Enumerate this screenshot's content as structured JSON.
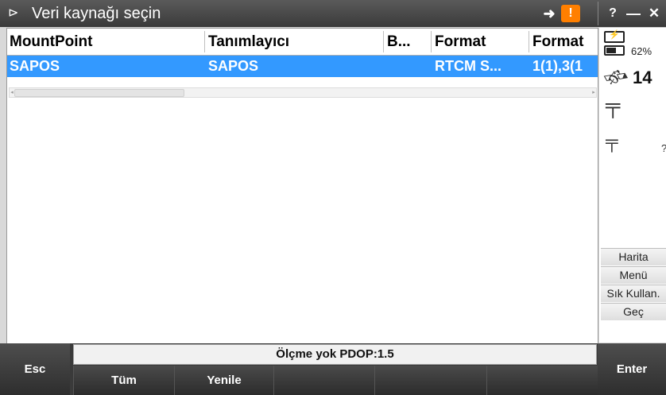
{
  "titlebar": {
    "title": "Veri kaynağı seçin",
    "app_icon": "satellite-dish-icon",
    "sync_icon": "sync-arrow-icon",
    "warning_glyph": "!",
    "help_label": "?",
    "min_label": "—",
    "close_label": "✕",
    "warning_color": "#ff7f00"
  },
  "table": {
    "columns": [
      "MountPoint",
      "Tanımlayıcı",
      "B...",
      "Format",
      "Format"
    ],
    "rows": [
      {
        "mountpoint": "SAPOS",
        "identifier": "SAPOS",
        "b": "",
        "format": "RTCM S...",
        "format2": "1(1),3(1"
      }
    ],
    "selected_color": "#3399ff"
  },
  "status_panel": {
    "battery_pct": "62%",
    "satellites": "14",
    "tripod2_value": "?"
  },
  "side_buttons": [
    "Harita",
    "Menü",
    "Sık Kullan.",
    "Geç"
  ],
  "status_line": "Ölçme yok  PDOP:1.5",
  "softkeys": {
    "esc": "Esc",
    "tum": "Tüm",
    "yenile": "Yenile",
    "enter": "Enter"
  }
}
